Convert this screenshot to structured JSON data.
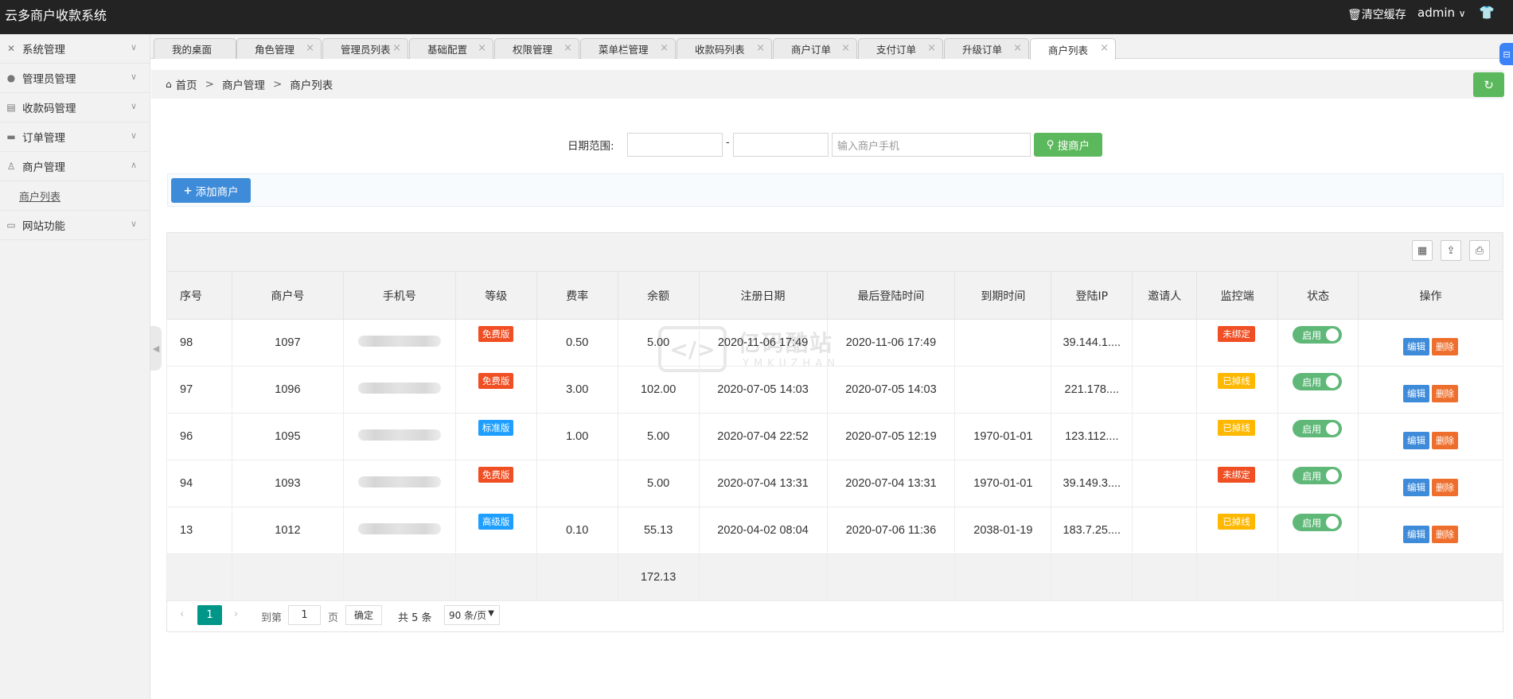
{
  "header": {
    "brand": "云多商户收款系统",
    "clear_cache": "清空缓存",
    "user": "admin",
    "user_arrow": "∨",
    "shirt_icon": "shirt-icon"
  },
  "sidebar": {
    "items": [
      {
        "label": "系统管理",
        "icon": "wrench-icon",
        "arrow": "∨"
      },
      {
        "label": "管理员管理",
        "icon": "user-icon",
        "arrow": "∨"
      },
      {
        "label": "收款码管理",
        "icon": "list-icon",
        "arrow": "∨"
      },
      {
        "label": "订单管理",
        "icon": "card-icon",
        "arrow": "∨"
      },
      {
        "label": "商户管理",
        "icon": "merchant-icon",
        "arrow": "∧"
      },
      {
        "label": "网站功能",
        "icon": "window-icon",
        "arrow": "∨"
      }
    ],
    "sub_item": "商户列表"
  },
  "tabs": [
    {
      "label": "我的桌面"
    },
    {
      "label": "角色管理"
    },
    {
      "label": "管理员列表"
    },
    {
      "label": "基础配置"
    },
    {
      "label": "权限管理"
    },
    {
      "label": "菜单栏管理"
    },
    {
      "label": "收款码列表"
    },
    {
      "label": "商户订单"
    },
    {
      "label": "支付订单"
    },
    {
      "label": "升级订单"
    },
    {
      "label": "商户列表"
    }
  ],
  "tab_close": "×",
  "breadcrumb": {
    "home": "首页",
    "level1": "商户管理",
    "level2": "商户列表",
    "sep": ">"
  },
  "search": {
    "date_label": "日期范围:",
    "dash": "-",
    "phone_placeholder": "输入商户手机",
    "button": "搜商户"
  },
  "add_button": "添加商户",
  "table": {
    "columns": [
      "序号",
      "商户号",
      "手机号",
      "等级",
      "费率",
      "余额",
      "注册日期",
      "最后登陆时间",
      "到期时间",
      "登陆IP",
      "邀请人",
      "监控端",
      "状态",
      "操作"
    ],
    "rows": [
      {
        "id": "98",
        "merchant": "1097",
        "level": "免费版",
        "level_type": "free",
        "rate": "0.50",
        "balance": "5.00",
        "reg": "2020-11-06 17:49",
        "last": "2020-11-06 17:49",
        "expire": "",
        "ip": "39.144.1....",
        "inviter": "",
        "monitor": "未绑定",
        "monitor_type": "red",
        "status": "启用"
      },
      {
        "id": "97",
        "merchant": "1096",
        "level": "免费版",
        "level_type": "free",
        "rate": "3.00",
        "balance": "102.00",
        "reg": "2020-07-05 14:03",
        "last": "2020-07-05 14:03",
        "expire": "",
        "ip": "221.178....",
        "inviter": "",
        "monitor": "已掉线",
        "monitor_type": "yel",
        "status": "启用"
      },
      {
        "id": "96",
        "merchant": "1095",
        "level": "标准版",
        "level_type": "std",
        "rate": "1.00",
        "balance": "5.00",
        "reg": "2020-07-04 22:52",
        "last": "2020-07-05 12:19",
        "expire": "1970-01-01",
        "ip": "123.112....",
        "inviter": "",
        "monitor": "已掉线",
        "monitor_type": "yel",
        "status": "启用"
      },
      {
        "id": "94",
        "merchant": "1093",
        "level": "免费版",
        "level_type": "free",
        "rate": "",
        "balance": "5.00",
        "reg": "2020-07-04 13:31",
        "last": "2020-07-04 13:31",
        "expire": "1970-01-01",
        "ip": "39.149.3....",
        "inviter": "",
        "monitor": "未绑定",
        "monitor_type": "red",
        "status": "启用"
      },
      {
        "id": "13",
        "merchant": "1012",
        "level": "高级版",
        "level_type": "adv",
        "rate": "0.10",
        "balance": "55.13",
        "reg": "2020-04-02 08:04",
        "last": "2020-07-06 11:36",
        "expire": "2038-01-19",
        "ip": "183.7.25....",
        "inviter": "",
        "monitor": "已掉线",
        "monitor_type": "yel",
        "status": "启用"
      }
    ],
    "total_balance": "172.13",
    "edit_label": "编辑",
    "delete_label": "删除"
  },
  "pager": {
    "prev": "‹",
    "current": "1",
    "next": "›",
    "goto": "到第",
    "page_input": "1",
    "page_unit": "页",
    "ok": "确定",
    "total": "共 5 条",
    "page_size": "90 条/页",
    "size_arrow": "▼"
  },
  "watermark": {
    "cn": "亿码酷站",
    "en": "YMKUZHAN",
    "symbol": "</>"
  },
  "colors": {
    "topbar": "#232323",
    "green": "#5cb85c",
    "blue": "#3e8bd9",
    "orange": "#ee6f2d",
    "red_badge": "#f04e23",
    "yellow_badge": "#ffb800",
    "teal_page": "#009688"
  }
}
